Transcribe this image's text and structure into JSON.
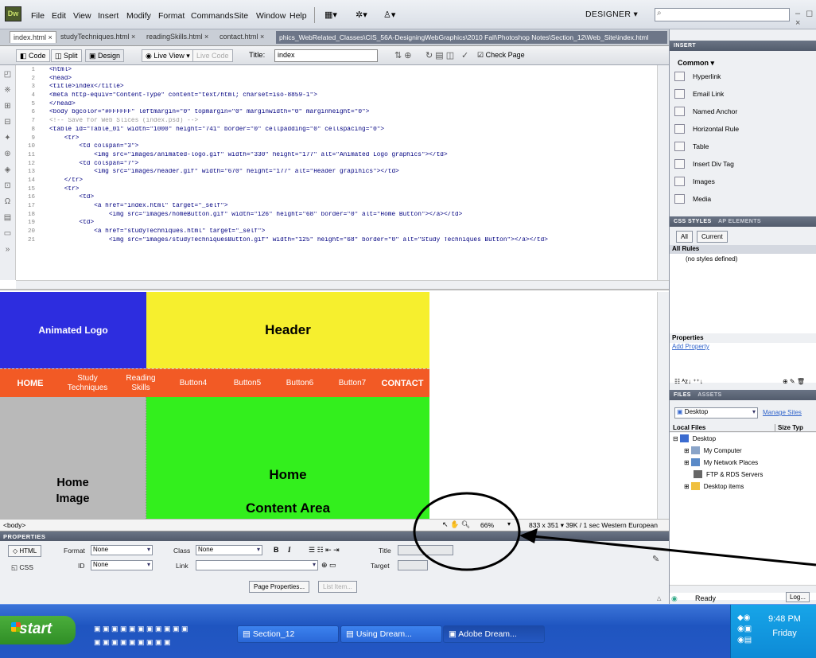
{
  "app": {
    "logo": "Dw",
    "menu": [
      "File",
      "Edit",
      "View",
      "Insert",
      "Modify",
      "Format",
      "Commands",
      "Site",
      "Window",
      "Help"
    ],
    "workspace": "DESIGNER"
  },
  "tabs": {
    "files": [
      "index.html",
      "studyTechniques.html",
      "readingSkills.html",
      "contact.html"
    ],
    "path": "phics_WebRelated_Classes\\CIS_56A-DesigningWebGraphics\\2010 Fall\\Photoshop Notes\\Section_12\\Web_Site\\index.html"
  },
  "toolbar": {
    "code": "Code",
    "split": "Split",
    "design": "Design",
    "live_view": "Live View",
    "live_code": "Live Code",
    "title_label": "Title:",
    "title_value": "index",
    "check_page": "Check Page"
  },
  "code": {
    "lines": [
      "<html>",
      "<head>",
      "<title>index</title>",
      "<meta http-equiv=\"Content-Type\" content=\"text/html; charset=iso-8859-1\">",
      "</head>",
      "<body bgcolor=\"#FFFFFF\" leftmargin=\"0\" topmargin=\"0\" marginwidth=\"0\" marginheight=\"0\">",
      "<!-- Save for Web Slices (index.psd) -->",
      "<table id=\"Table_01\" width=\"1000\" height=\"741\" border=\"0\" cellpadding=\"0\" cellspacing=\"0\">",
      "    <tr>",
      "        <td colspan=\"3\">",
      "            <img src=\"images/animated-logo.gif\" width=\"330\" height=\"177\" alt=\"Animated Logo graphics\"></td>",
      "        <td colspan=\"7\">",
      "            <img src=\"images/header.gif\" width=\"670\" height=\"177\" alt=\"Header grapihics\"></td>",
      "    </tr>",
      "    <tr>",
      "        <td>",
      "            <a href=\"index.html\" target=\"_self\">",
      "                <img src=\"images/homeButton.gif\" width=\"126\" height=\"68\" border=\"0\" alt=\"Home Button\"></a></td>",
      "        <td>",
      "            <a href=\"studyTechniques.html\" target=\"_self\">",
      "                <img src=\"images/studyTechniquesButton.gif\" width=\"125\" height=\"68\" border=\"0\" alt=\"Study Techniques Button\"></a></td>"
    ],
    "numbers": [
      "1",
      "2",
      "3",
      "4",
      "5",
      "6",
      "7",
      "8",
      "9",
      "10",
      "11",
      "12",
      "13",
      "14",
      "15",
      "16",
      "17",
      "18",
      "19",
      "20",
      "21"
    ]
  },
  "design": {
    "animated_logo": "Animated Logo",
    "header": "Header",
    "nav": {
      "home": "HOME",
      "study_1": "Study",
      "study_2": "Techniques",
      "reading_1": "Reading",
      "reading_2": "Skills",
      "b4": "Button4",
      "b5": "Button5",
      "b6": "Button6",
      "b7": "Button7",
      "contact": "CONTACT"
    },
    "home_image_1": "Home",
    "home_image_2": "Image",
    "content_1": "Home",
    "content_2": "Content Area"
  },
  "status": {
    "tag": "<body>",
    "zoom": "66%",
    "info": "833 x 351 ▾  39K / 1 sec  Western European"
  },
  "properties": {
    "title": "PROPERTIES",
    "html": "HTML",
    "css": "CSS",
    "format_label": "Format",
    "format_value": "None",
    "class_label": "Class",
    "class_value": "None",
    "id_label": "ID",
    "id_value": "None",
    "link_label": "Link",
    "title_label": "Title",
    "target_label": "Target",
    "page_props": "Page Properties...",
    "list_item": "List Item..."
  },
  "panels": {
    "insert_tab": "INSERT",
    "common": "Common",
    "insert_items": [
      "Hyperlink",
      "Email Link",
      "Named Anchor",
      "Horizontal Rule",
      "Table",
      "Insert Div Tag",
      "Images",
      "Media"
    ],
    "css_tab": "CSS STYLES",
    "ap_tab": "AP ELEMENTS",
    "all": "All",
    "current": "Current",
    "all_rules": "All Rules",
    "no_styles": "(no styles defined)",
    "properties": "Properties",
    "add_property": "Add Property",
    "files_tab": "FILES",
    "assets_tab": "ASSETS",
    "site": "Desktop",
    "manage": "Manage Sites",
    "local_files": "Local Files",
    "size_type": "Size Typ",
    "tree": [
      "Desktop",
      "My Computer",
      "My Network Places",
      "FTP & RDS Servers",
      "Desktop items"
    ],
    "ready": "Ready",
    "log": "Log..."
  },
  "taskbar": {
    "start": "start",
    "tasks": [
      "Section_12",
      "Using Dream...",
      "Adobe Dream..."
    ],
    "time": "9:48 PM",
    "day": "Friday"
  },
  "colors": {
    "logo_blue": "#2d2ddf",
    "header_yellow": "#f6ef2e",
    "nav_orange": "#f25a25",
    "image_gray": "#b9b9b9",
    "content_green": "#33ef1d"
  }
}
